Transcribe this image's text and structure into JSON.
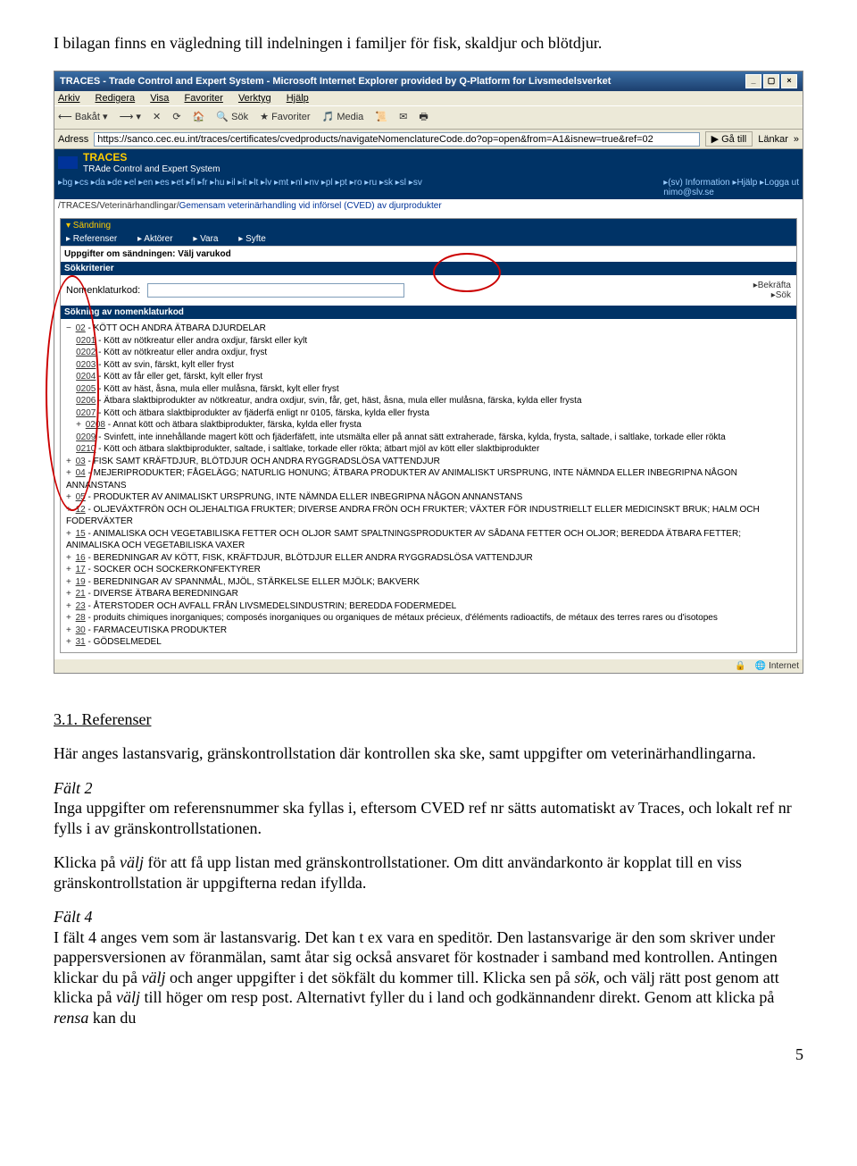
{
  "intro": "I bilagan finns en vägledning till indelningen i familjer för fisk, skaldjur och blötdjur.",
  "page_number": "5",
  "browser": {
    "title": "TRACES - Trade Control and Expert System - Microsoft Internet Explorer provided by Q-Platform for Livsmedelsverket",
    "menu": [
      "Arkiv",
      "Redigera",
      "Visa",
      "Favoriter",
      "Verktyg",
      "Hjälp"
    ],
    "toolbar": [
      "Bakåt",
      "Sök",
      "Favoriter",
      "Media"
    ],
    "address_label": "Adress",
    "address_url": "https://sanco.cec.eu.int/traces/certificates/cvedproducts/navigateNomenclatureCode.do?op=open&from=A1&isnew=true&ref=02",
    "go_label": "Gå till",
    "links_label": "Länkar",
    "status_zone": "Internet"
  },
  "traces": {
    "brand": "TRACES",
    "brand_sub": "TRAde Control and Expert System",
    "langs": "▸bg ▸cs ▸da ▸de ▸el ▸en ▸es ▸et ▸fi ▸fr ▸hu ▸il ▸it ▸lt ▸lv ▸mt ▸nl ▸nv ▸pl ▸pt ▸ro ▸ru ▸sk ▸sl ▸sv",
    "right_links": "▸(sv) Information   ▸Hjälp   ▸Logga ut",
    "user": "nimo@slv.se",
    "breadcrumb_static": "/TRACES/Veterinärhandlingar/",
    "breadcrumb_link": "Gemensam veterinärhandling vid införsel (CVED) av djurprodukter",
    "tab_main": "▾ Sändning",
    "tabs_row2": [
      "▸ Referenser",
      "▸ Aktörer",
      "▸ Vara",
      "▸ Syfte"
    ],
    "section_title": "Uppgifter om sändningen: Välj varukod",
    "search_title": "Sökkriterier",
    "search_label": "Nomenklaturkod:",
    "btn_confirm": "▸Bekräfta",
    "btn_search": "▸Sök",
    "result_title": "Sökning av nomenklaturkod",
    "lines": [
      "− 02 - KÖTT OCH ANDRA ÄTBARA DJURDELAR",
      "0201 - Kött av nötkreatur eller andra oxdjur, färskt eller kylt",
      "0202 - Kött av nötkreatur eller andra oxdjur, fryst",
      "0203 - Kött av svin, färskt, kylt eller fryst",
      "0204 - Kött av får eller get, färskt, kylt eller fryst",
      "0205 - Kött av häst, åsna, mula eller mulåsna, färskt, kylt eller fryst",
      "0206 - Ätbara slaktbiprodukter av nötkreatur, andra oxdjur, svin, får, get, häst, åsna, mula eller mulåsna, färska, kylda eller frysta",
      "0207 - Kött och ätbara slaktbiprodukter av fjäderfä enligt nr 0105, färska, kylda eller frysta",
      "+ 0208 - Annat kött och ätbara slaktbiprodukter, färska, kylda eller frysta",
      "0209 - Svinfett, inte innehållande magert kött och fjäderfäfett, inte utsmälta eller på annat sätt extraherade, färska, kylda, frysta, saltade, i saltlake, torkade eller rökta",
      "0210 - Kött och ätbara slaktbiprodukter, saltade, i saltlake, torkade eller rökta; ätbart mjöl av kött eller slaktbiprodukter",
      "+ 03 - FISK SAMT KRÄFTDJUR, BLÖTDJUR OCH ANDRA RYGGRADSLÖSA VATTENDJUR",
      "+ 04 - MEJERIPRODUKTER; FÅGELÄGG; NATURLIG HONUNG; ÄTBARA PRODUKTER AV ANIMALISKT URSPRUNG, INTE NÄMNDA ELLER INBEGRIPNA NÅGON ANNANSTANS",
      "+ 05 - PRODUKTER AV ANIMALISKT URSPRUNG, INTE NÄMNDA ELLER INBEGRIPNA NÅGON ANNANSTANS",
      "+ 12 - OLJEVÄXTFRÖN OCH OLJEHALTIGA FRUKTER; DIVERSE ANDRA FRÖN OCH FRUKTER; VÄXTER FÖR INDUSTRIELLT ELLER MEDICINSKT BRUK; HALM OCH FODERVÄXTER",
      "+ 15 - ANIMALISKA OCH VEGETABILISKA FETTER OCH OLJOR SAMT SPALTNINGSPRODUKTER AV SÅDANA FETTER OCH OLJOR; BEREDDA ÄTBARA FETTER; ANIMALISKA OCH VEGETABILISKA VAXER",
      "+ 16 - BEREDNINGAR AV KÖTT, FISK, KRÄFTDJUR, BLÖTDJUR ELLER ANDRA RYGGRADSLÖSA VATTENDJUR",
      "+ 17 - SOCKER OCH SOCKERKONFEKTYRER",
      "+ 19 - BEREDNINGAR AV SPANNMÅL, MJÖL, STÄRKELSE ELLER MJÖLK; BAKVERK",
      "+ 21 - DIVERSE ÄTBARA BEREDNINGAR",
      "+ 23 - ÅTERSTODER OCH AVFALL FRÅN LIVSMEDELSINDUSTRIN; BEREDDA FODERMEDEL",
      "+ 28 - produits chimiques inorganiques; composés inorganiques ou organiques de métaux précieux, d'éléments radioactifs, de métaux des terres rares ou d'isotopes",
      "+ 30 - FARMACEUTISKA PRODUKTER",
      "+ 31 - GÖDSELMEDEL"
    ]
  },
  "section": {
    "heading": "3.1. Referenser",
    "p1": "Här anges lastansvarig, gränskontrollstation där kontrollen ska ske, samt uppgifter om veterinärhandlingarna.",
    "f2_head": "Fält 2",
    "f2_body": "Inga uppgifter om referensnummer ska fyllas i, eftersom CVED ref nr sätts automatiskt av Traces, och lokalt ref nr fylls i av gränskontrollstationen.",
    "p3a": "Klicka på ",
    "p3_em": "välj",
    "p3b": " för att få upp listan med gränskontrollstationer. Om ditt användarkonto är kopplat till en viss gränskontrollstation är uppgifterna redan ifyllda.",
    "f4_head": "Fält 4",
    "p4a": "I fält 4 anges vem som är lastansvarig. Det kan t ex vara en speditör. Den lastansvarige är den som skriver under pappersversionen av föranmälan, samt åtar sig också ansvaret för kostnader i samband med kontrollen. Antingen klickar du på ",
    "p4_em1": "välj",
    "p4b": " och anger uppgifter i det sökfält du kommer till. Klicka sen på ",
    "p4_em2": "sök",
    "p4c": ", och välj rätt post genom att klicka på ",
    "p4_em3": "välj",
    "p4d": " till höger om resp post. Alternativt fyller du i land och godkännandenr direkt. Genom att klicka på ",
    "p4_em4": "rensa",
    "p4e": " kan du"
  }
}
